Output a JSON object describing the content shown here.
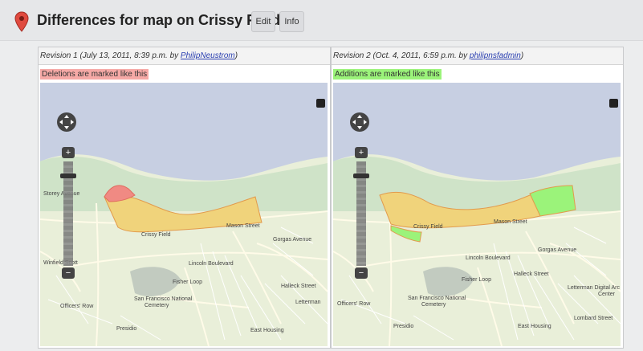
{
  "header": {
    "title": "Differences for map on Crissy Field",
    "edit_label": "Edit",
    "info_label": "Info"
  },
  "colors": {
    "deletion": "#f6a9a6",
    "addition": "#9bf37a",
    "area_fill": "#f0d37b",
    "water": "#c7cfe2",
    "land": "#e9efd9"
  },
  "revisions": [
    {
      "prefix": "Revision 1 (July 13, 2011, 8:39 p.m. by ",
      "user": "PhilipNeustrom",
      "suffix": ")",
      "legend": "Deletions are marked like this"
    },
    {
      "prefix": "Revision 2 (Oct. 4, 2011, 6:59 p.m. by ",
      "user": "philipnsfadmin",
      "suffix": ")",
      "legend": "Additions are marked like this"
    }
  ],
  "map_labels_left": {
    "crissy": "Crissy Field",
    "mason": "Mason Street",
    "lincoln": "Lincoln Boulevard",
    "fisher": "Fisher Loop",
    "cemetery1": "San Francisco National",
    "cemetery2": "Cemetery",
    "officers": "Officers' Row",
    "presidio": "Presidio",
    "east_housing": "East Housing",
    "letterman": "Letterman",
    "gorgas": "Gorgas Avenue",
    "halleck": "Halleck Street",
    "winfield": "Winfield Scott",
    "storey": "Storey Avenue"
  },
  "map_labels_right": {
    "crissy": "Crissy Field",
    "mason": "Mason Street",
    "lincoln": "Lincoln Boulevard",
    "fisher": "Fisher Loop",
    "cemetery1": "San Francisco National",
    "cemetery2": "Cemetery",
    "officers": "Officers' Row",
    "presidio": "Presidio",
    "east_housing": "East Housing",
    "letterman": "Letterman Digital Arc",
    "letterman2": "Center",
    "gorgas": "Gorgas Avenue",
    "halleck": "Halleck Street",
    "lombard": "Lombard Street"
  }
}
